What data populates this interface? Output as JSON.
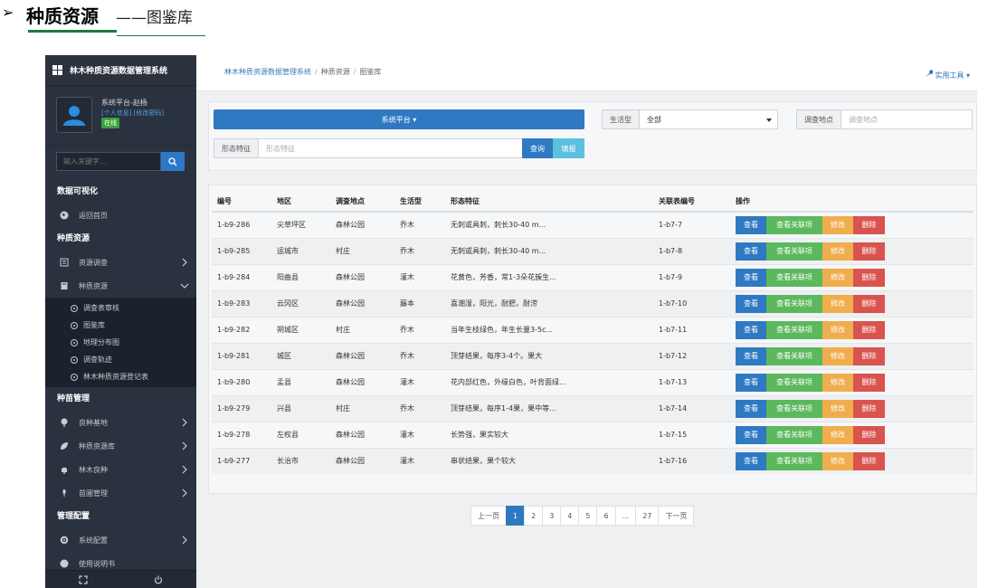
{
  "slide": {
    "title": "种质资源",
    "subtitle": "——图鉴库"
  },
  "sidebar": {
    "app_title": "林木种质资源数据管理系统",
    "user": {
      "name": "系统平台-赵杨",
      "links": "[个人信息] [修改密码]",
      "status": "在线"
    },
    "search_placeholder": "输入关键字...",
    "sections": {
      "viz": "数据可视化",
      "germplasm": "种质资源",
      "seedling": "种苗管理",
      "config": "管理配置"
    },
    "items": {
      "home": "返回首页",
      "survey": "资源调查",
      "germplasm": "种质资源",
      "base": "良种基地",
      "bank": "种质资源库",
      "fine": "林木良种",
      "nursery": "苗圃管理",
      "sysconfig": "系统配置",
      "manual": "使用说明书"
    },
    "subitems": [
      "调查表审核",
      "图鉴库",
      "地理分布图",
      "调查轨迹",
      "林木种质资源登记表"
    ],
    "icons": [
      "home-icon",
      "survey-icon",
      "book-icon",
      "tree-icon",
      "leaf-icon",
      "bell-icon",
      "flask-icon",
      "gear-icon"
    ]
  },
  "topbar": {
    "breadcrumb": [
      "林木种质资源数据管理系统",
      "种质资源",
      "图鉴库"
    ],
    "tools": "实用工具"
  },
  "filters": {
    "platform": "系统平台",
    "life_type_label": "生活型",
    "life_type_value": "全部",
    "location_label": "调查地点",
    "location_placeholder": "调查地点",
    "feature_label": "形态特征",
    "feature_placeholder": "形态特征",
    "query_btn": "查询",
    "fill_btn": "填报"
  },
  "table": {
    "headers": [
      "编号",
      "地区",
      "调查地点",
      "生活型",
      "形态特征",
      "关联表编号",
      "操作"
    ],
    "actions": {
      "view": "查看",
      "related": "查看关联项",
      "edit": "修改",
      "delete": "删除"
    },
    "rows": [
      [
        "1-b9-286",
        "尖草坪区",
        "森林公园",
        "乔木",
        "无刺或具刺，刺长30-40 m...",
        "1-b7-7"
      ],
      [
        "1-b9-285",
        "运城市",
        "村庄",
        "乔木",
        "无刺或具刺，刺长30-40 m...",
        "1-b7-8"
      ],
      [
        "1-b9-284",
        "阳曲县",
        "森林公园",
        "灌木",
        "花黄色，芳香，常1-3朵花簇生...",
        "1-b7-9"
      ],
      [
        "1-b9-283",
        "云冈区",
        "森林公园",
        "藤本",
        "喜潮湿，阳光，耐肥，耐涝",
        "1-b7-10"
      ],
      [
        "1-b9-282",
        "朔城区",
        "村庄",
        "乔木",
        "当年生枝绿色，年生长量3-5c...",
        "1-b7-11"
      ],
      [
        "1-b9-281",
        "城区",
        "森林公园",
        "乔木",
        "顶芽结果，每序3-4个。果大",
        "1-b7-12"
      ],
      [
        "1-b9-280",
        "盂县",
        "森林公园",
        "灌木",
        "花内部红色，外缘白色，叶背面绿...",
        "1-b7-13"
      ],
      [
        "1-b9-279",
        "兴县",
        "村庄",
        "乔木",
        "顶芽结果，每序1-4果，果中等...",
        "1-b7-14"
      ],
      [
        "1-b9-278",
        "左权县",
        "森林公园",
        "灌木",
        "长势强，果实较大",
        "1-b7-15"
      ],
      [
        "1-b9-277",
        "长治市",
        "森林公园",
        "灌木",
        "串状结果，果个较大",
        "1-b7-16"
      ]
    ]
  },
  "pagination": {
    "prev": "上一页",
    "pages": [
      "1",
      "2",
      "3",
      "4",
      "5",
      "6",
      "...",
      "27"
    ],
    "current": "1",
    "next": "下一页"
  }
}
